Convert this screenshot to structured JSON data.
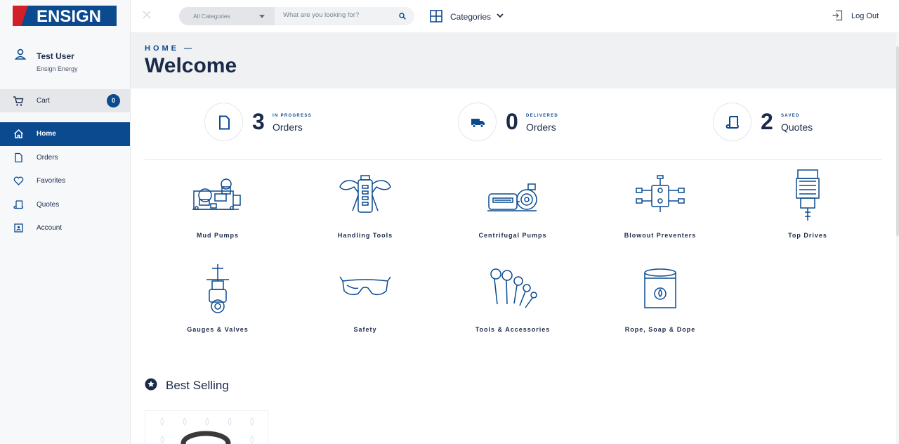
{
  "brand": {
    "logo_text": "ENSIGN",
    "primary_color": "#0b4a8f",
    "accent_color": "#d32028"
  },
  "user": {
    "name": "Test User",
    "org": "Ensign Energy"
  },
  "cart": {
    "label": "Cart",
    "count": "0"
  },
  "nav": [
    {
      "label": "Home",
      "icon": "home-icon",
      "active": true
    },
    {
      "label": "Orders",
      "icon": "document-icon",
      "active": false
    },
    {
      "label": "Favorites",
      "icon": "heart-icon",
      "active": false
    },
    {
      "label": "Quotes",
      "icon": "scroll-icon",
      "active": false
    },
    {
      "label": "Account",
      "icon": "account-card-icon",
      "active": false
    }
  ],
  "topbar": {
    "category_select": "All Categories",
    "search_placeholder": "What are you looking for?",
    "categories_label": "Categories",
    "logout_label": "Log Out"
  },
  "header": {
    "breadcrumb": "HOME —",
    "title": "Welcome"
  },
  "stats": [
    {
      "number": "3",
      "tag": "IN PROGRESS",
      "label": "Orders",
      "icon": "document-icon"
    },
    {
      "number": "0",
      "tag": "DELIVERED",
      "label": "Orders",
      "icon": "truck-icon"
    },
    {
      "number": "2",
      "tag": "SAVED",
      "label": "Quotes",
      "icon": "scroll-icon"
    }
  ],
  "categories": [
    {
      "label": "Mud Pumps",
      "icon": "mud-pump-icon"
    },
    {
      "label": "Handling Tools",
      "icon": "handling-tool-icon"
    },
    {
      "label": "Centrifugal Pumps",
      "icon": "centrifugal-pump-icon"
    },
    {
      "label": "Blowout Preventers",
      "icon": "blowout-preventer-icon"
    },
    {
      "label": "Top Drives",
      "icon": "top-drive-icon"
    },
    {
      "label": "Gauges & Valves",
      "icon": "valve-icon"
    },
    {
      "label": "Safety",
      "icon": "safety-glasses-icon"
    },
    {
      "label": "Tools & Accessories",
      "icon": "wrenches-icon"
    },
    {
      "label": "Rope, Soap & Dope",
      "icon": "bucket-icon"
    }
  ],
  "best_selling": {
    "title": "Best Selling"
  }
}
